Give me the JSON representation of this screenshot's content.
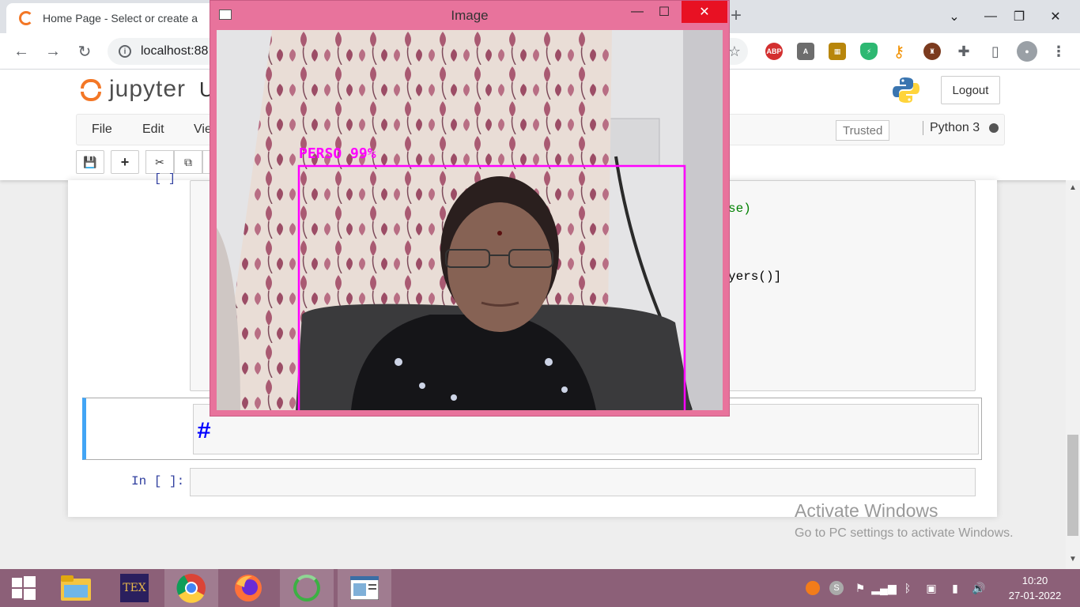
{
  "browser": {
    "tab_title": "Home Page - Select or create a",
    "url": "localhost:88"
  },
  "jupyter": {
    "logo_text": "jupyter",
    "notebook_name": "U",
    "logout_label": "Logout",
    "menu": [
      "File",
      "Edit",
      "Vie"
    ],
    "trusted_label": "Trusted",
    "kernel_label": "Python 3"
  },
  "notebook": {
    "cell1_prompt": "[ ]",
    "code_frag_1": "se)",
    "code_frag_2": "yers()]",
    "markdown_text": "#",
    "cell3_prompt": "In [ ]:"
  },
  "image_window": {
    "title": "Image",
    "detection_label": "PERSO 99%",
    "box_color": "#ff00ff"
  },
  "watermark": {
    "line1": "Activate Windows",
    "line2": "Go to PC settings to activate Windows."
  },
  "taskbar": {
    "time": "10:20",
    "date": "27-01-2022"
  },
  "colors": {
    "jupyter_orange": "#f37726",
    "taskbar": "#8c6078",
    "image_window_frame": "#e8739c",
    "selected_cell_accent": "#42a5f5"
  }
}
